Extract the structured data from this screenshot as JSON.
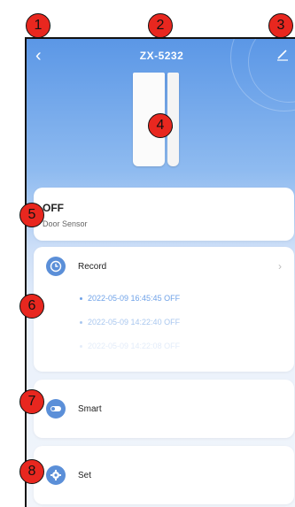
{
  "header": {
    "title": "ZX-5232",
    "back_icon": "back-icon",
    "edit_icon": "edit-icon"
  },
  "status": {
    "value": "OFF",
    "device_type": "Door Sensor"
  },
  "record": {
    "label": "Record",
    "icon": "clock-icon",
    "entries": [
      "2022-05-09 16:45:45 OFF",
      "2022-05-09 14:22:40 OFF",
      "2022-05-09 14:22:08 OFF"
    ]
  },
  "smart": {
    "label": "Smart",
    "icon": "toggle-icon"
  },
  "set": {
    "label": "Set",
    "icon": "gear-icon"
  },
  "markers": [
    "1",
    "2",
    "3",
    "4",
    "5",
    "6",
    "7",
    "8"
  ],
  "colors": {
    "accent": "#5b8fd8",
    "marker": "#e8271f",
    "record_text": "#6fa2e8"
  }
}
